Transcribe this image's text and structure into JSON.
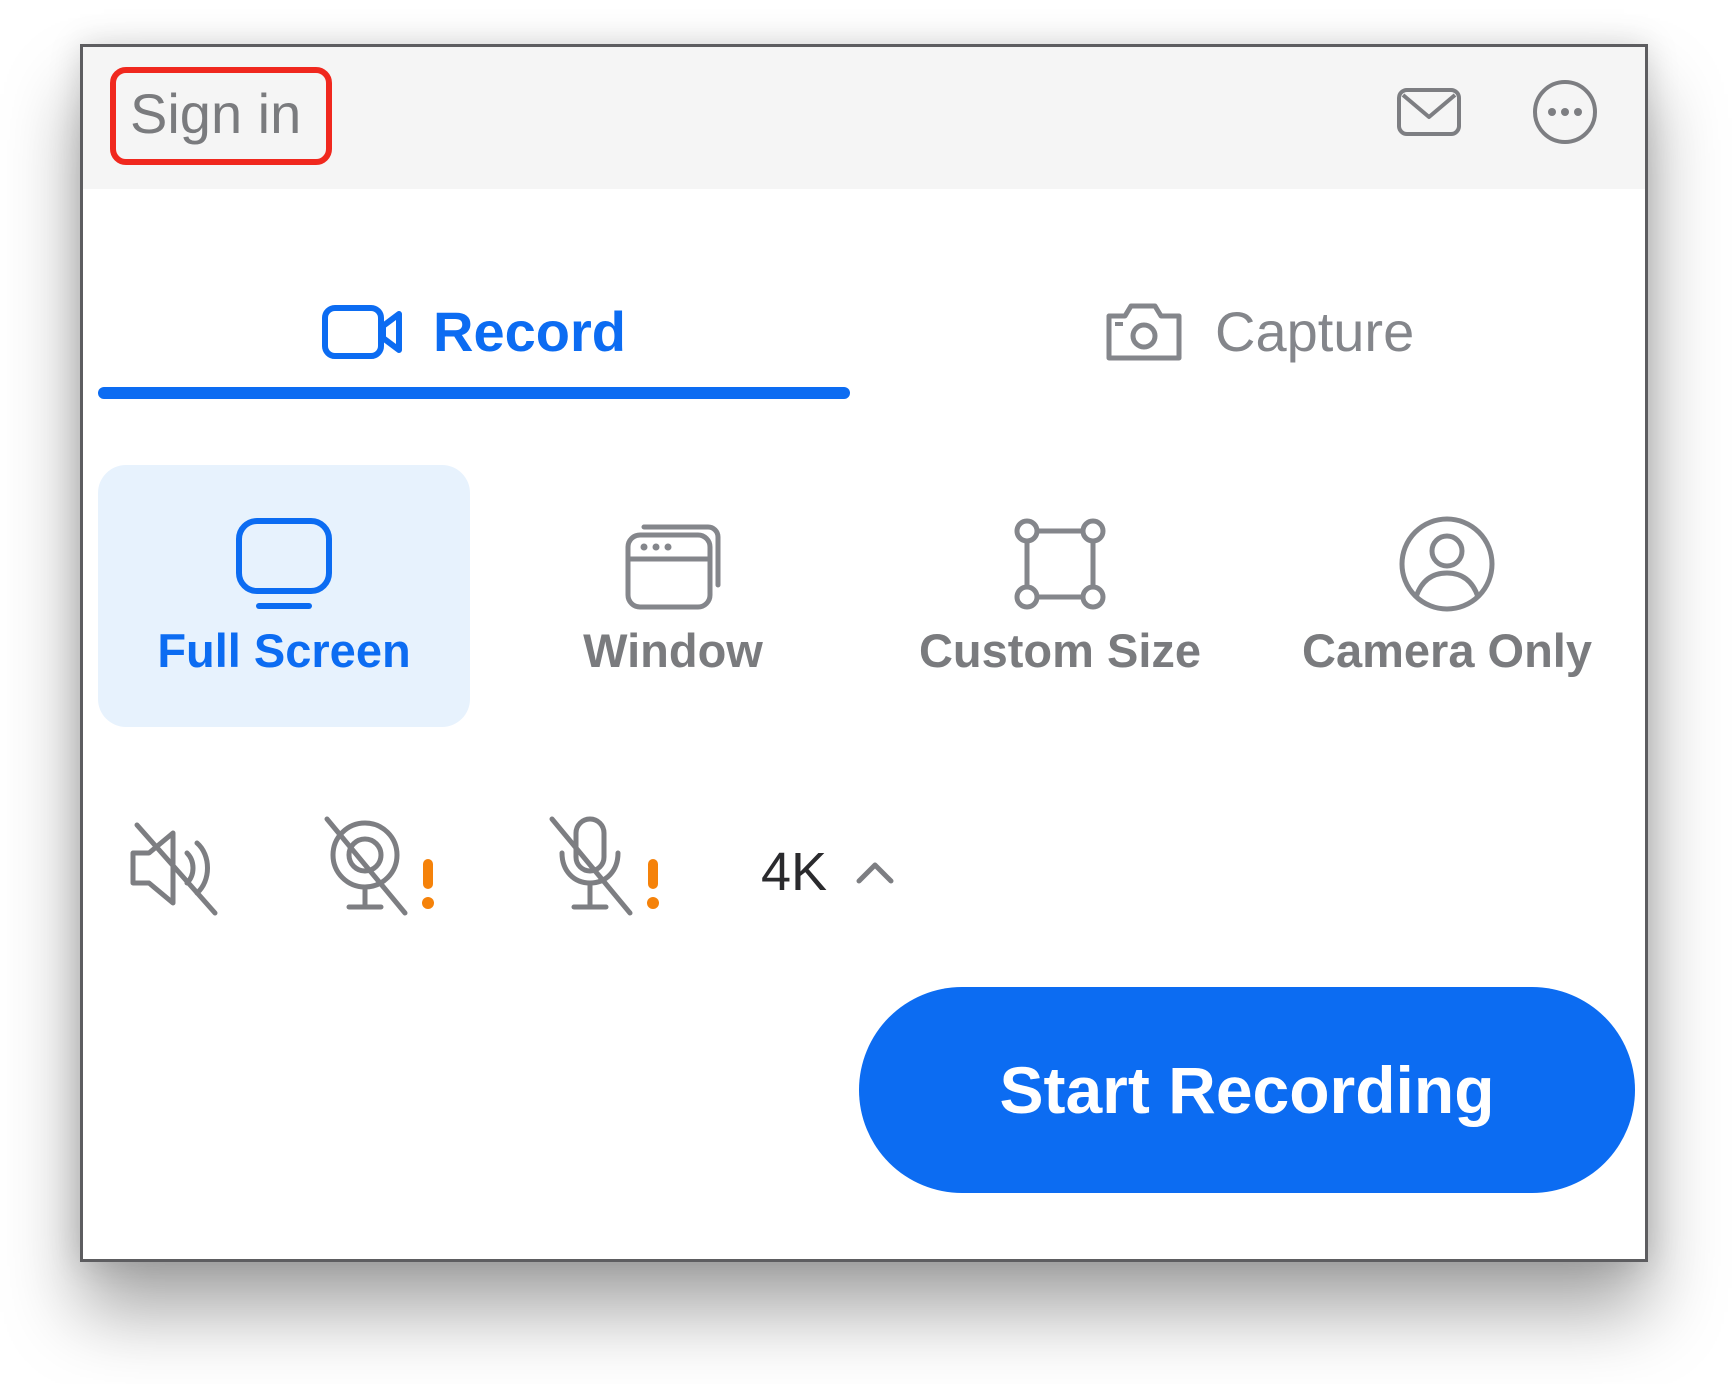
{
  "titlebar": {
    "signin_label": "Sign in",
    "icons": [
      "mail-icon",
      "more-options-icon"
    ]
  },
  "tabs": [
    {
      "label": "Record",
      "icon": "video-camera-icon",
      "selected": true
    },
    {
      "label": "Capture",
      "icon": "photo-camera-icon",
      "selected": false
    }
  ],
  "modes": [
    {
      "label": "Full Screen",
      "icon": "monitor-icon",
      "selected": true
    },
    {
      "label": "Window",
      "icon": "window-icon",
      "selected": false
    },
    {
      "label": "Custom Size",
      "icon": "custom-size-icon",
      "selected": false
    },
    {
      "label": "Camera Only",
      "icon": "user-circle-icon",
      "selected": false
    }
  ],
  "controls": {
    "system_audio_icon": "speaker-muted-icon",
    "webcam_icon": "webcam-off-icon",
    "microphone_icon": "microphone-off-icon",
    "warning_icon": "exclamation-icon",
    "resolution_label": "4K",
    "resolution_icon": "chevron-up-icon"
  },
  "start_button_label": "Start Recording",
  "colors": {
    "accent": "#0c6cf2",
    "selected_bg": "#e7f2fd",
    "highlight_border": "#f0281e",
    "warning": "#f5820a",
    "muted_text": "#7a7b7e"
  }
}
